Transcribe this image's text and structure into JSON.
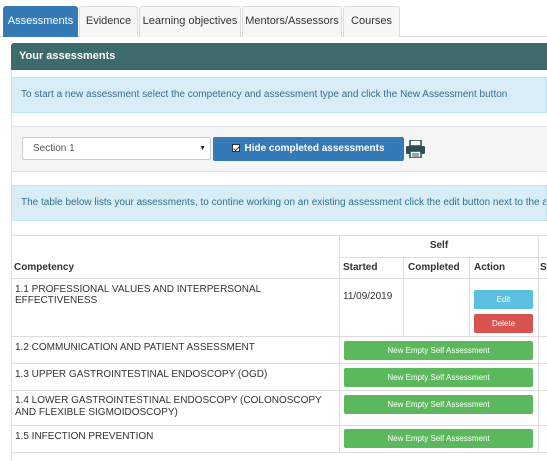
{
  "tabs": [
    "Assessments",
    "Evidence",
    "Learning objectives",
    "Mentors/Assessors",
    "Courses"
  ],
  "panel_title": "Your assessments",
  "intro_text": "To start a new assessment select the competency and assessment type and click the New Assessment button",
  "filter": {
    "section_value": "Section 1",
    "hide_completed_label": "Hide completed assessments",
    "hide_completed_checked": true,
    "print_icon": "print-icon"
  },
  "table_info_text": "The table below lists your assessments, to contine working on an existing assessment click the edit button next to the assessm",
  "table": {
    "group_header": "Self",
    "headers": {
      "competency": "Competency",
      "started": "Started",
      "completed": "Completed",
      "action": "Action",
      "next": "St"
    },
    "rows": [
      {
        "competency": "1.1 PROFESSIONAL VALUES AND INTERPERSONAL EFFECTIVENESS",
        "started": "11/09/2019",
        "completed": "",
        "actions": [
          "Edit",
          "Delete"
        ]
      },
      {
        "competency": "1.2 COMMUNICATION AND PATIENT ASSESSMENT",
        "button": "New Empty Self Assessment"
      },
      {
        "competency": "1.3 UPPER GASTROINTESTINAL ENDOSCOPY (OGD)",
        "button": "New Empty Self Assessment"
      },
      {
        "competency": "1.4 LOWER GASTROINTESTINAL ENDOSCOPY (COLONOSCOPY AND FLEXIBLE SIGMOIDOSCOPY)",
        "button": "New Empty Self Assessment"
      },
      {
        "competency": "1.5 INFECTION PREVENTION",
        "button": "New Empty Self Assessment"
      }
    ]
  },
  "colors": {
    "primary": "#337ab7",
    "panel_heading": "#3d6b6b",
    "info_bg": "#d9edf7",
    "success": "#5cb85c",
    "info_button": "#5bc0de",
    "danger": "#d9534f"
  }
}
